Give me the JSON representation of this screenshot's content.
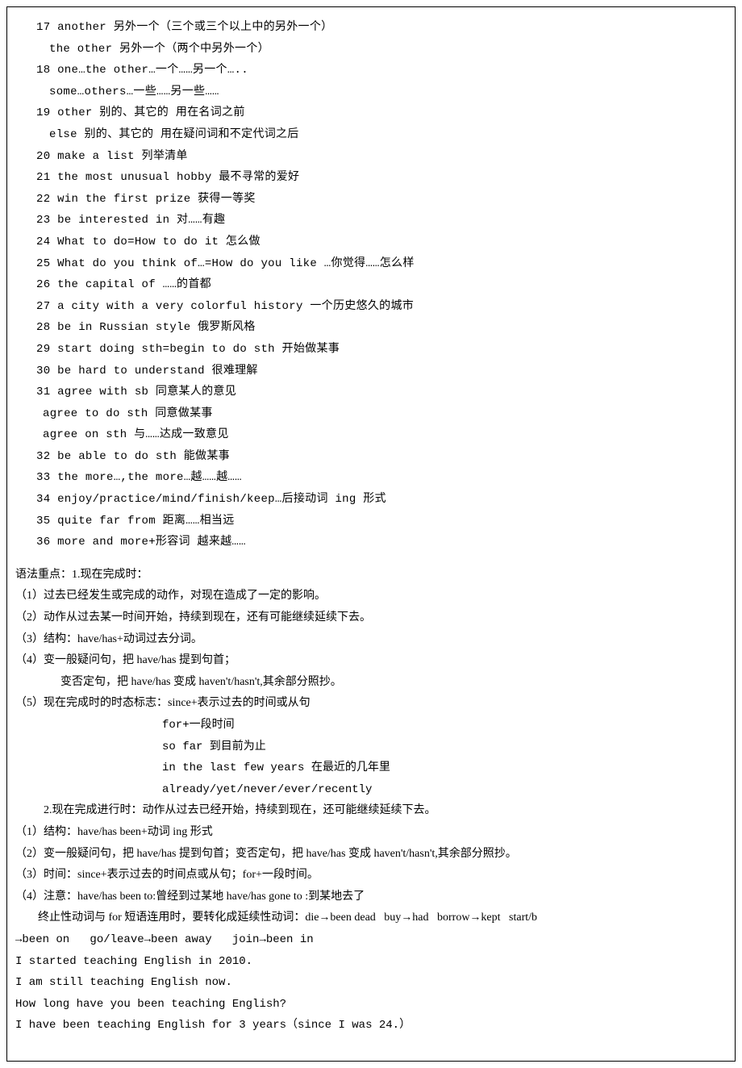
{
  "vocab": {
    "l17a": "17 another 另外一个（三个或三个以上中的另外一个）",
    "l17b": "the other 另外一个（两个中另外一个）",
    "l18a": "18 one…the other…一个……另一个…..",
    "l18b": "some…others…一些……另一些……",
    "l19a": "19 other 别的、其它的 用在名词之前",
    "l19b": "else 别的、其它的 用在疑问词和不定代词之后",
    "l20": "20 make a list 列举清单",
    "l21": "21 the most unusual hobby 最不寻常的爱好",
    "l22": "22 win the first prize 获得一等奖",
    "l23": "23 be interested in 对……有趣",
    "l24": "24 What to do=How to do it 怎么做",
    "l25": "25 What do you think of…=How do you like …你觉得……怎么样",
    "l26": "26 the capital of ……的首都",
    "l27": "27 a city with a very colorful history 一个历史悠久的城市",
    "l28": "28 be in Russian style 俄罗斯风格",
    "l29": "29 start doing sth=begin to do sth 开始做某事",
    "l30": "30 be hard to understand 很难理解",
    "l31a": "31 agree with sb 同意某人的意见",
    "l31b": "agree to do sth 同意做某事",
    "l31c": "agree on sth 与……达成一致意见",
    "l32": "32 be able to do sth 能做某事",
    "l33": "33 the more…,the more…越……越……",
    "l34": "34 enjoy/practice/mind/finish/keep…后接动词 ing 形式",
    "l35": "35 quite far from 距离……相当远",
    "l36": "36 more and more+形容词 越来越……"
  },
  "grammar": {
    "head": "语法重点：1.现在完成时：",
    "g1": "（1）过去已经发生或完成的动作，对现在造成了一定的影响。",
    "g2": "（2）动作从过去某一时间开始，持续到现在，还有可能继续延续下去。",
    "g3": "（3）结构：have/has+动词过去分词。",
    "g4a": "（4）变一般疑问句，把 have/has 提到句首；",
    "g4b": "变否定句，把 have/has 变成 haven't/hasn't,其余部分照抄。",
    "g5a": "（5）现在完成时的时态标志：since+表示过去的时间或从句",
    "g5b": "for+一段时间",
    "g5c": "so far 到目前为止",
    "g5d": "in the last few years 在最近的几年里",
    "g5e": "already/yet/never/ever/recently",
    "head2a": "          2.现在完成进行时：动作从过去已经开始，持续到现在，还可能继续延续下去。",
    "p1": "（1）结构：have/has been+动词 ing 形式",
    "p2": "（2）变一般疑问句，把 have/has 提到句首；变否定句，把 have/has 变成 haven't/hasn't,其余部分照抄。",
    "p3": "（3）时间：since+表示过去的时间点或从句；for+一段时间。",
    "p4a": "（4）注意：have/has been to:曾经到过某地 have/has gone to :到某地去了",
    "p4b": "终止性动词与 for 短语连用时，要转化成延续性动词：die→been dead   buy→had   borrow→kept   start/b",
    "p4c": "→been on   go/leave→been away   join→been in",
    "ex1": "I started teaching English in 2010.",
    "ex2": "I am still teaching English now.",
    "ex3": "How long have you been teaching English?",
    "ex4": "I have been teaching English for 3 years（since I was 24.）"
  }
}
